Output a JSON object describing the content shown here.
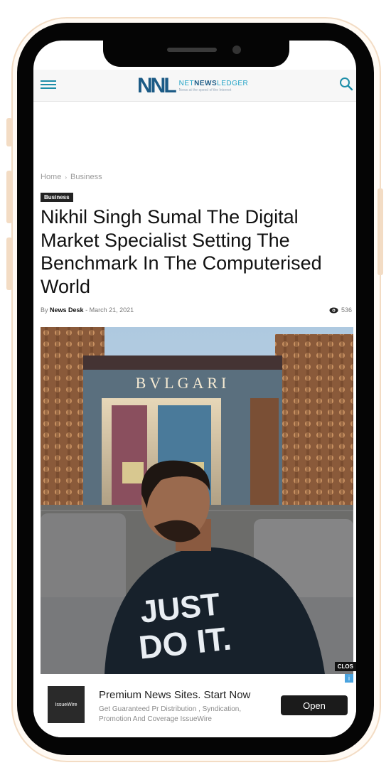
{
  "header": {
    "logo_mark": "NNL",
    "logo_name_a": "NET",
    "logo_name_b": "NEWS",
    "logo_name_c": "LEDGER",
    "logo_tagline": "News at the speed of the Internet"
  },
  "breadcrumb": {
    "home": "Home",
    "separator": "›",
    "current": "Business"
  },
  "article": {
    "category": "Business",
    "title": "Nikhil Singh Sumal The Digital Market Specialist Setting The Benchmark In The Computerised World",
    "by_label": "By",
    "author": "News Desk",
    "dash": "-",
    "date": "March 21, 2021",
    "views": "536",
    "photo_text": {
      "store_sign": "BVLGARI",
      "shirt_line1": "JUST",
      "shirt_line2": "DO IT."
    }
  },
  "ad": {
    "close_label": "CLOS",
    "info_glyph": "i",
    "logo_text": "IssueWire",
    "headline": "Premium News Sites. Start Now",
    "description": "Get Guaranteed Pr Distribution , Syndication, Promotion And Coverage IssueWire",
    "button_label": "Open"
  },
  "colors": {
    "accent": "#1d8ea9",
    "logo_dark": "#1c5b86",
    "logo_light": "#1fa2c6",
    "phone_frame": "#050505",
    "phone_trim": "#f3dcc4"
  },
  "icons": [
    "menu-icon",
    "search-icon",
    "eye-icon"
  ]
}
